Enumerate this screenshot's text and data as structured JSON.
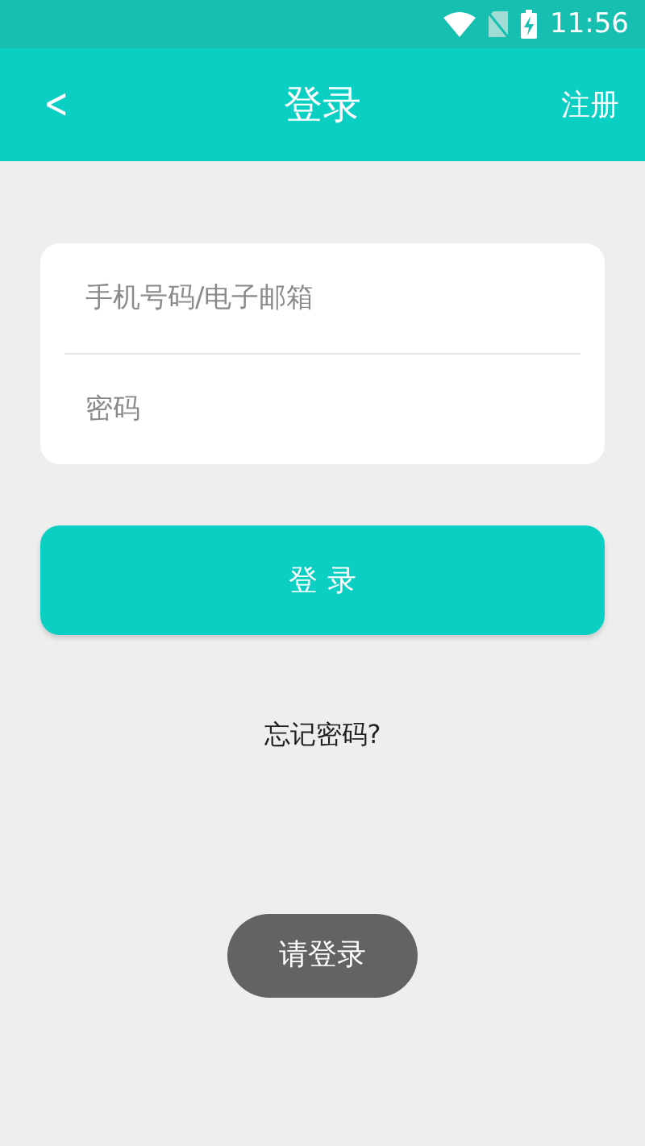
{
  "status_bar": {
    "time": "11:56"
  },
  "header": {
    "back": "<",
    "title": "登录",
    "action": "注册"
  },
  "form": {
    "fields": [
      {
        "placeholder": "手机号码/电子邮箱"
      },
      {
        "placeholder": "密码"
      }
    ]
  },
  "login_button": "登 录",
  "forgot_link": "忘记密码?",
  "toast": "请登录"
}
